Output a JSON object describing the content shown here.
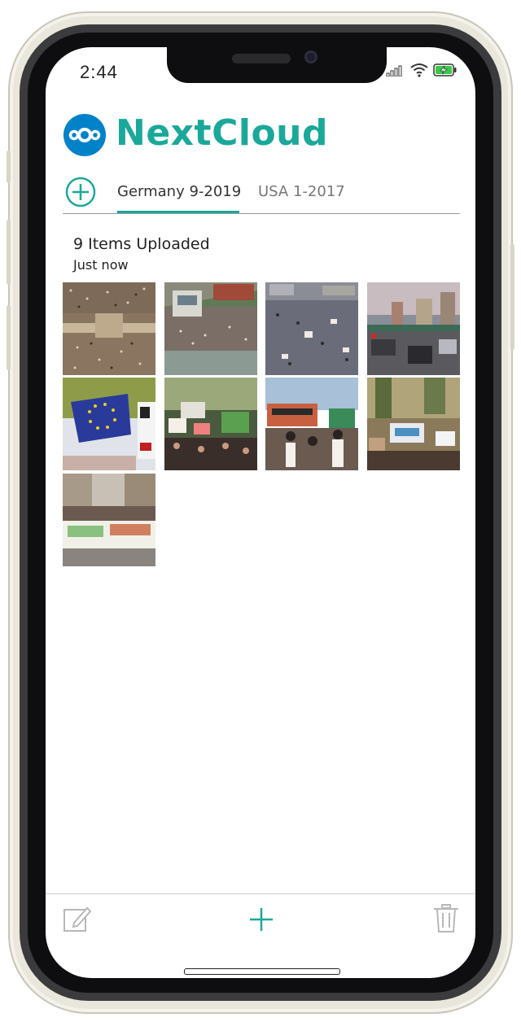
{
  "status_bar": {
    "time": "2:44",
    "icons": [
      "cellular-signal-icon",
      "wifi-icon",
      "battery-charging-icon"
    ]
  },
  "header": {
    "logo_icon": "nextcloud-logo-icon",
    "title": "NextCloud",
    "brand_color": "#1aa89a",
    "logo_color": "#0082c9"
  },
  "tabs": [
    {
      "label": "Germany 9-2019",
      "selected": true
    },
    {
      "label": "USA 1-2017",
      "selected": false
    }
  ],
  "add_album_icon": "circle-plus-icon",
  "upload": {
    "count_text": "9 Items Uploaded",
    "time_text": "Just now"
  },
  "photos": [
    {
      "name": "aerial-crowd-square"
    },
    {
      "name": "aerial-crowd-building"
    },
    {
      "name": "dense-crowd-signs"
    },
    {
      "name": "city-street-traffic"
    },
    {
      "name": "eu-flag-protest"
    },
    {
      "name": "protest-crowd-placards"
    },
    {
      "name": "welt-sign-protest"
    },
    {
      "name": "protest-signs-trees"
    },
    {
      "name": "klima-banner-march"
    }
  ],
  "toolbar": {
    "left_icon": "edit-icon",
    "center_icon": "plus-icon",
    "right_icon": "trash-icon"
  }
}
